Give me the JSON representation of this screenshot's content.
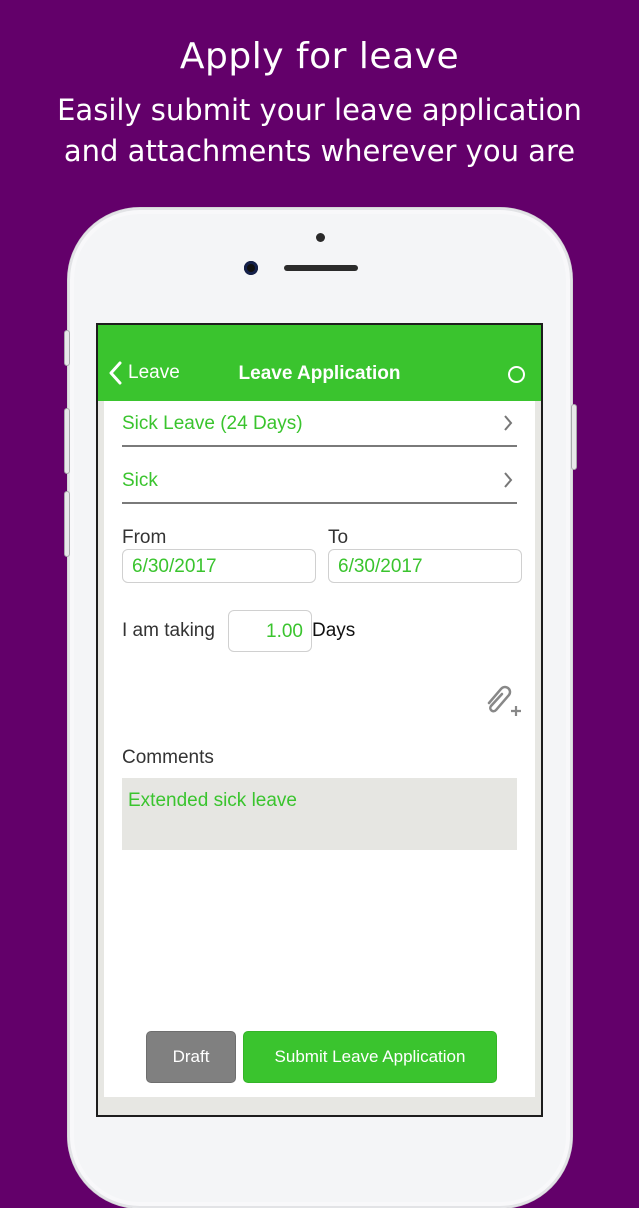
{
  "promo": {
    "title": "Apply for leave",
    "subtitle_line1": "Easily submit your leave application",
    "subtitle_line2": "and attachments wherever you are"
  },
  "colors": {
    "background": "#63006a",
    "accent": "#3ac42e",
    "draft_button": "#808080",
    "comments_bg": "#e6e6e2"
  },
  "navbar": {
    "back_label": "Leave",
    "back_icon": "chevron-left-icon",
    "title": "Leave Application",
    "status_icon": "circle-icon"
  },
  "form": {
    "leave_type": {
      "value": "Sick Leave (24 Days)",
      "icon": "chevron-right-icon"
    },
    "reason": {
      "value": "Sick",
      "icon": "chevron-right-icon"
    },
    "from": {
      "label": "From",
      "value": "6/30/2017"
    },
    "to": {
      "label": "To",
      "value": "6/30/2017"
    },
    "taking": {
      "prefix": "I am taking",
      "value": "1.00",
      "suffix": "Days"
    },
    "attachment_icon": "paperclip-add-icon",
    "comments": {
      "label": "Comments",
      "value": "Extended sick leave"
    }
  },
  "actions": {
    "draft_label": "Draft",
    "submit_label": "Submit Leave Application"
  }
}
